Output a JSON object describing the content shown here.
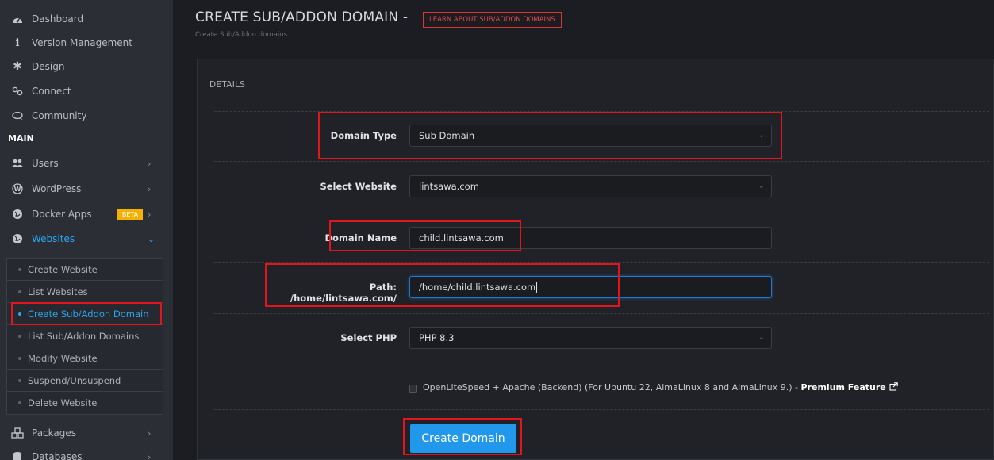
{
  "sidebar": {
    "items_top": [
      {
        "label": "Dashboard",
        "icon": "tachometer-icon"
      },
      {
        "label": "Version Management",
        "icon": "info-icon"
      },
      {
        "label": "Design",
        "icon": "gear-icon"
      },
      {
        "label": "Connect",
        "icon": "link-icon"
      },
      {
        "label": "Community",
        "icon": "chat-icon"
      }
    ],
    "section_main": "MAIN",
    "items_main": [
      {
        "label": "Users",
        "icon": "users-icon"
      },
      {
        "label": "WordPress",
        "icon": "wordpress-icon"
      },
      {
        "label": "Docker Apps",
        "icon": "globe-icon",
        "badge": "BETA"
      },
      {
        "label": "Websites",
        "icon": "globe-icon"
      }
    ],
    "websites_submenu": [
      "Create Website",
      "List Websites",
      "Create Sub/Addon Domain",
      "List Sub/Addon Domains",
      "Modify Website",
      "Suspend/Unsuspend",
      "Delete Website"
    ],
    "items_bottom": [
      {
        "label": "Packages",
        "icon": "cubes-icon"
      },
      {
        "label": "Databases",
        "icon": "database-icon"
      }
    ]
  },
  "header": {
    "title": "CREATE SUB/ADDON DOMAIN -",
    "learn_link": "LEARN ABOUT SUB/ADDON DOMAINS",
    "subtitle": "Create Sub/Addon domains."
  },
  "form": {
    "section_title": "DETAILS",
    "domain_type": {
      "label": "Domain Type",
      "value": "Sub Domain"
    },
    "select_website": {
      "label": "Select Website",
      "value": "lintsawa.com"
    },
    "domain_name": {
      "label": "Domain Name",
      "value": "child.lintsawa.com"
    },
    "path": {
      "label": "Path: /home/lintsawa.com/",
      "value": "/home/child.lintsawa.com"
    },
    "select_php": {
      "label": "Select PHP",
      "value": "PHP 8.3"
    },
    "backend_checkbox": {
      "text": "OpenLiteSpeed + Apache (Backend) (For Ubuntu 22, AlmaLinux 8 and AlmaLinux 9.) -",
      "link": "Premium Feature",
      "checked": false
    },
    "submit_label": "Create Domain"
  },
  "colors": {
    "accent": "#2aa7ef",
    "highlight": "#e3141c",
    "beta": "#f6b100"
  }
}
